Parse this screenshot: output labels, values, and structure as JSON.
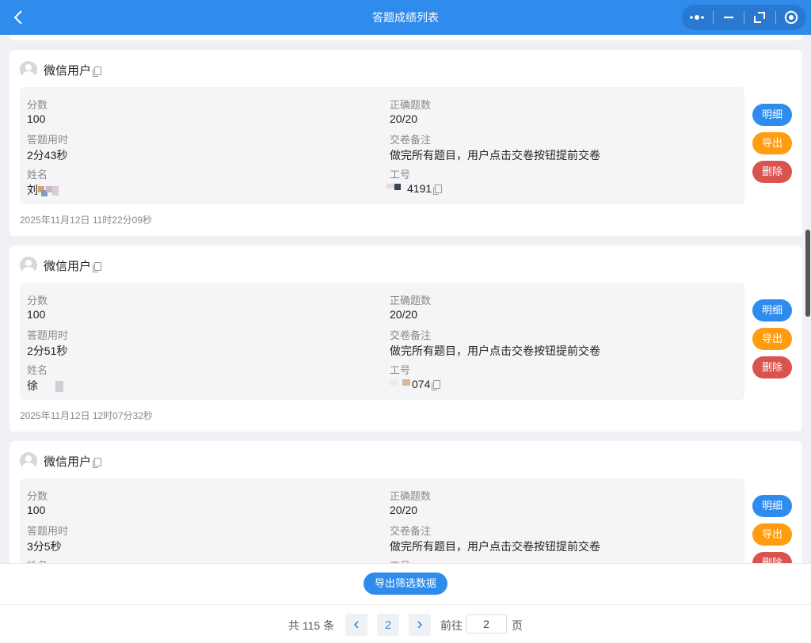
{
  "navbar": {
    "title": "答题成绩列表",
    "back_icon": "chevron-left-icon",
    "capsule": [
      "more-dots-icon",
      "minimize-icon",
      "restore-icon",
      "close-target-icon"
    ]
  },
  "labels": {
    "score": "分数",
    "correct": "正确题数",
    "duration": "答题用时",
    "remark": "交卷备注",
    "name": "姓名",
    "employee_id": "工号",
    "detail_btn": "明细",
    "export_btn": "导出",
    "delete_btn": "删除"
  },
  "records": [
    {
      "user": "微信用户",
      "score": "100",
      "correct": "20/20",
      "duration": "2分43秒",
      "remark": "做完所有题目，用户点击交卷按钮提前交卷",
      "name": "刘",
      "employee_id": "4191",
      "time": "2025年11月12日 11时22分09秒"
    },
    {
      "user": "微信用户",
      "score": "100",
      "correct": "20/20",
      "duration": "2分51秒",
      "remark": "做完所有题目，用户点击交卷按钮提前交卷",
      "name": "徐",
      "employee_id": "074",
      "time": "2025年11月12日 12时07分32秒"
    },
    {
      "user": "微信用户",
      "score": "100",
      "correct": "20/20",
      "duration": "3分5秒",
      "remark": "做完所有题目，用户点击交卷按钮提前交卷",
      "name": "",
      "employee_id": "",
      "time": ""
    }
  ],
  "footer": {
    "export_filtered": "导出筛选数据",
    "total_text": "共 115 条",
    "current_page": "2",
    "goto_label": "前往",
    "goto_value": "2",
    "page_unit": "页"
  },
  "colors": {
    "primary": "#2f8ced",
    "export": "#ff9c0f",
    "delete": "#d9534f"
  }
}
